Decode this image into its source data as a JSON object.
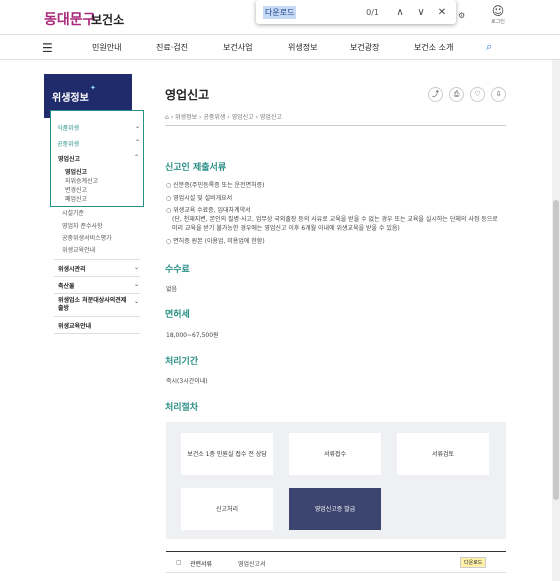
{
  "header": {
    "logo_text": "동대문구",
    "site_name": "보건소",
    "find": {
      "query": "다운로드",
      "count": "0/1",
      "up": "∧",
      "down": "∨",
      "close": "✕"
    },
    "login_label": "로그인"
  },
  "nav": {
    "items": [
      "민원안내",
      "진료·검진",
      "보건사업",
      "위생정보",
      "보건광장",
      "보건소 소개"
    ]
  },
  "sidebar": {
    "title": "위생정보",
    "groups": [
      {
        "label": "식품위생"
      },
      {
        "label": "공중위생"
      }
    ],
    "sub": [
      {
        "label": "영업신고"
      },
      {
        "label": "영업신고"
      },
      {
        "label": "지위승계신고"
      },
      {
        "label": "변경신고"
      },
      {
        "label": "폐업신고"
      },
      {
        "label": "시설기준"
      },
      {
        "label": "영업자 준수사항"
      },
      {
        "label": "공중위생서비스평가"
      },
      {
        "label": "위생교육안내"
      }
    ],
    "more": [
      {
        "label": "위생시관리"
      },
      {
        "label": "축산물"
      },
      {
        "label": "위생업소 처분대상사의견제출방"
      },
      {
        "label": "위생교육안내"
      }
    ]
  },
  "main": {
    "title": "영업신고",
    "breadcrumb": "⌂ › 위생정보 › 공중위생 › 영업신고 › 영업신고",
    "sections": {
      "docs_title": "신고인 제출서류",
      "docs": [
        "신분증(주민등록증 또는 운전면허증)",
        "영업시설 및 설비개요서",
        "위생교육 수료증, 임대차계약서",
        "(단, 천재지변, 본인의 질병·사고, 업무상 국외출장 등의 사유로 교육을 받을 수 없는 경우 또는 교육을 실시하는 단체의 사정 등으로",
        "미리 교육을 받기 불가능한 경우에는 영업신고 이후 6개월 이내에 위생교육을 받을 수 있음)",
        "면허증 원본 (이용업, 미용업에 한함)"
      ],
      "fee_title": "수수료",
      "fee": "없음",
      "license_title": "면허세",
      "license": "18,000~67,500원",
      "period_title": "처리기간",
      "period": "즉시(3시간이내)",
      "process_title": "처리절차",
      "process": [
        "보건소 1층 민원실 접수 전 상담",
        "서류접수",
        "서류검토",
        "신고처리",
        "영업신고증 발급"
      ]
    },
    "doc_row": {
      "label": "관련서류",
      "name": "영업신고서",
      "download": "다운로드"
    }
  }
}
